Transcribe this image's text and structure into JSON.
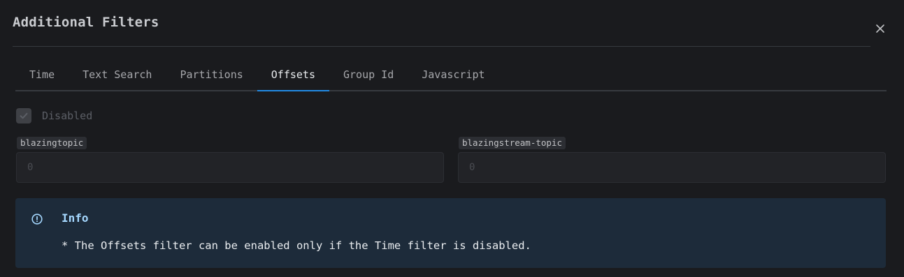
{
  "dialog": {
    "title": "Additional Filters",
    "close_icon": "close-icon"
  },
  "tabs": [
    {
      "label": "Time",
      "active": false
    },
    {
      "label": "Text Search",
      "active": false
    },
    {
      "label": "Partitions",
      "active": false
    },
    {
      "label": "Offsets",
      "active": true
    },
    {
      "label": "Group Id",
      "active": false
    },
    {
      "label": "Javascript",
      "active": false
    }
  ],
  "offsets": {
    "disabled_checkbox": {
      "label": "Disabled",
      "checked": true
    },
    "fields": [
      {
        "label": "blazingtopic",
        "placeholder": "0"
      },
      {
        "label": "blazingstream-topic",
        "placeholder": "0"
      }
    ]
  },
  "info": {
    "icon": "info-circle-icon",
    "title": "Info",
    "text": "* The Offsets filter can be enabled only if the Time filter is disabled."
  },
  "colors": {
    "background": "#1a1b1e",
    "accent": "#228be6",
    "info_background": "#1d2b3a",
    "info_title": "#a5d8ff"
  }
}
